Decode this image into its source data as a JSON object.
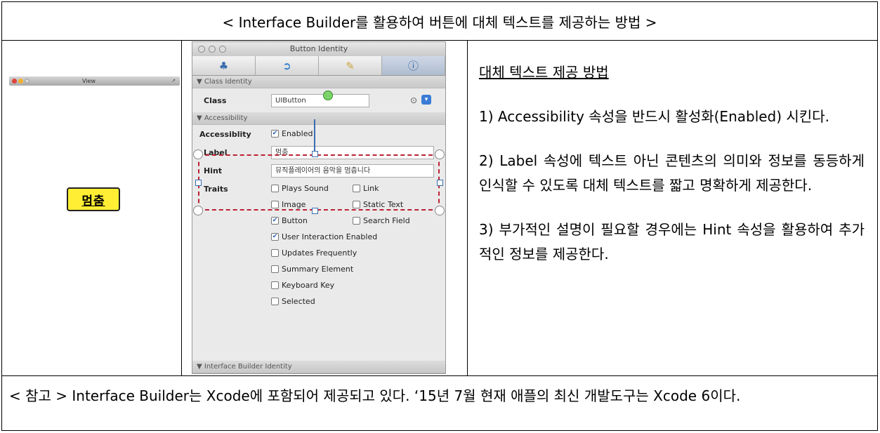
{
  "title": "< Interface Builder를 활용하여 버튼에 대체 텍스트를 제공하는 방법 >",
  "left_view": {
    "window_title": "View",
    "button_label": "멈춤"
  },
  "inspector": {
    "window_title": "Button Identity",
    "tabs": [
      "attributes-icon",
      "connections-icon",
      "size-icon",
      "identity-icon"
    ],
    "class_section": "▼ Class Identity",
    "class_label": "Class",
    "class_value": "UIButton",
    "accessibility_section": "▼ Accessibility",
    "accessibility_label": "Accessiblity",
    "enabled_label": "Enabled",
    "label_label": "Label",
    "label_value": "멈춤",
    "hint_label": "Hint",
    "hint_value": "뮤직플레이어의 음악을 멈춥니다",
    "traits_label": "Traits",
    "traits": {
      "plays_sound": "Plays Sound",
      "link": "Link",
      "image": "Image",
      "static_text": "Static Text",
      "button": "Button",
      "search_field": "Search Field",
      "user_interaction": "User Interaction Enabled",
      "updates_frequently": "Updates Frequently",
      "summary_element": "Summary Element",
      "keyboard_key": "Keyboard Key",
      "selected": "Selected"
    },
    "footer_section": "▼ Interface Builder Identity"
  },
  "method": {
    "heading": "대체 텍스트 제공 방법",
    "step1": "1) Accessibility 속성을 반드시 활성화(Enabled) 시킨다.",
    "step2": "2) Label 속성에 텍스트 아닌 콘텐츠의 의미와 정보를 동등하게 인식할 수 있도록 대체 텍스트를 짧고 명확하게 제공한다.",
    "step3": "3) 부가적인 설명이 필요할 경우에는 Hint 속성을 활용하여 추가적인 정보를 제공한다."
  },
  "note": "< 참고 > Interface Builder는 Xcode에 포함되어 제공되고 있다. ‘15년 7월 현재 애플의 최신 개발도구는 Xcode 6이다."
}
